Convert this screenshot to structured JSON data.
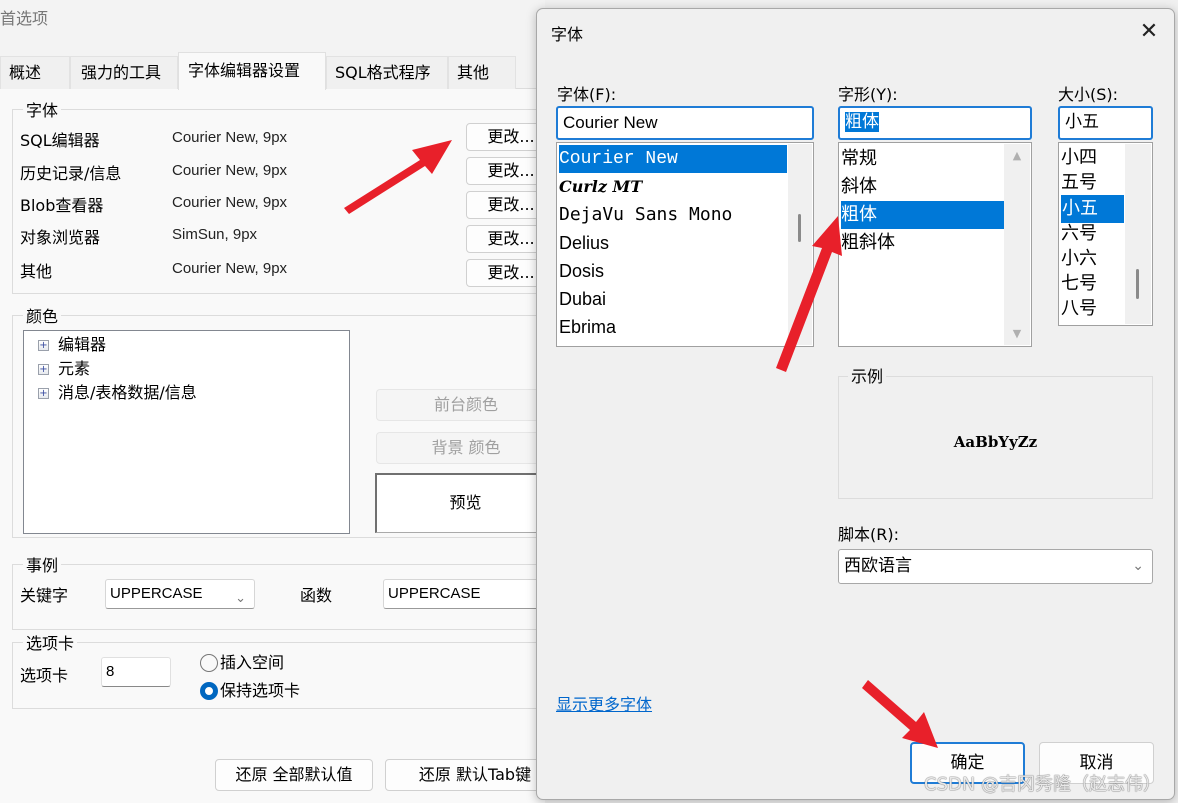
{
  "prefs": {
    "title": "首选项",
    "tabs": [
      {
        "label": "概述",
        "active": false
      },
      {
        "label": "强力的工具",
        "active": false
      },
      {
        "label": "字体编辑器设置",
        "active": true
      },
      {
        "label": "SQL格式程序",
        "active": false
      },
      {
        "label": "其他",
        "active": false
      }
    ],
    "fonts_group": {
      "label": "字体",
      "rows": [
        {
          "name": "SQL编辑器",
          "value": "Courier New, 9px",
          "button": "更改..."
        },
        {
          "name": "历史记录/信息",
          "value": "Courier New, 9px",
          "button": "更改..."
        },
        {
          "name": "Blob查看器",
          "value": "Courier New, 9px",
          "button": "更改..."
        },
        {
          "name": "对象浏览器",
          "value": "SimSun, 9px",
          "button": "更改..."
        },
        {
          "name": "其他",
          "value": "Courier New, 9px",
          "button": "更改..."
        }
      ]
    },
    "colors_group": {
      "label": "颜色",
      "tree": [
        "编辑器",
        "元素",
        "消息/表格数据/信息"
      ],
      "foreground_button": "前台颜色",
      "background_button": "背景 颜色",
      "preview": "预览"
    },
    "case_group": {
      "label": "事例",
      "keyword_label": "关键字",
      "keyword_value": "UPPERCASE",
      "function_label": "函数",
      "function_value": "UPPERCASE"
    },
    "tab_group": {
      "label": "选项卡",
      "tab_label": "选项卡",
      "tab_value": "8",
      "radio_insert": "插入空间",
      "radio_keep": "保持选项卡",
      "selected": "keep"
    },
    "restore_all_button": "还原 全部默认值",
    "restore_tab_button": "还原 默认Tab键"
  },
  "font_dialog": {
    "title": "字体",
    "close_icon": "close-icon",
    "font_label": "字体(F):",
    "font_value": "Courier New",
    "font_list": [
      "Courier New",
      "Curlz MT",
      "DejaVu Sans Mono",
      "Delius",
      "Dosis",
      "Dubai",
      "Ebrima"
    ],
    "font_selected": "Courier New",
    "style_label": "字形(Y):",
    "style_value": "粗体",
    "style_list": [
      "常规",
      "斜体",
      "粗体",
      "粗斜体"
    ],
    "style_selected": "粗体",
    "size_label": "大小(S):",
    "size_value": "小五",
    "size_list": [
      "小四",
      "五号",
      "小五",
      "六号",
      "小六",
      "七号",
      "八号"
    ],
    "size_selected": "小五",
    "sample_label": "示例",
    "sample_text": "AaBbYyZz",
    "script_label": "脚本(R):",
    "script_value": "西欧语言",
    "more_fonts_link": "显示更多字体",
    "ok_button": "确定",
    "cancel_button": "取消"
  },
  "watermark": "CSDN @吉冈秀隆（赵志伟）",
  "annotation_color": "#e8202a"
}
